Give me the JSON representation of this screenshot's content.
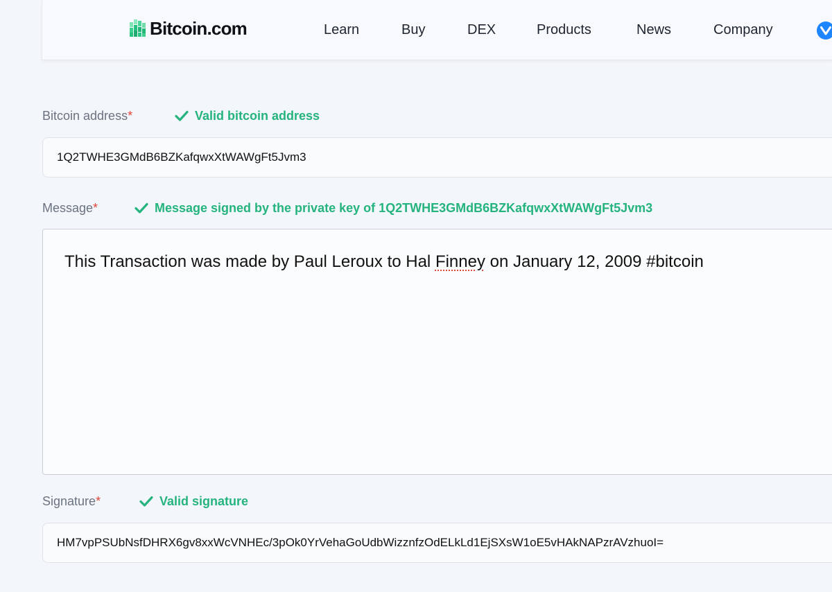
{
  "header": {
    "logo_text": "Bitcoin.com",
    "nav": [
      "Learn",
      "Buy",
      "DEX",
      "Products",
      "News",
      "Company"
    ],
    "icons": {
      "logo": "bitcoin-com-logo-icon",
      "right": "verse-icon"
    }
  },
  "form": {
    "address": {
      "label": "Bitcoin address",
      "required_mark": "*",
      "status": "Valid bitcoin address",
      "value": "1Q2TWHE3GMdB6BZKafqwxXtWAWgFt5Jvm3"
    },
    "message": {
      "label": "Message",
      "required_mark": "*",
      "status": "Message signed by the private key of 1Q2TWHE3GMdB6BZKafqwxXtWAWgFt5Jvm3",
      "value_before": "This Transaction was made by Paul Leroux to Hal ",
      "value_misspelled": "Finney",
      "value_after": " on January 12, 2009 #bitcoin"
    },
    "signature": {
      "label": "Signature",
      "required_mark": "*",
      "status": "Valid signature",
      "value": "HM7vpPSUbNsfDHRX6gv8xxWcVNHEc/3pOk0YrVehaGoUdbWizznfzOdELkLd1EjSXsW1oE5vHAkNAPzrAVzhuoI="
    }
  },
  "colors": {
    "valid_green": "#25b37e",
    "required_red": "#e2453c",
    "logo_green": "#26c281",
    "verse_blue": "#1d85ff"
  }
}
